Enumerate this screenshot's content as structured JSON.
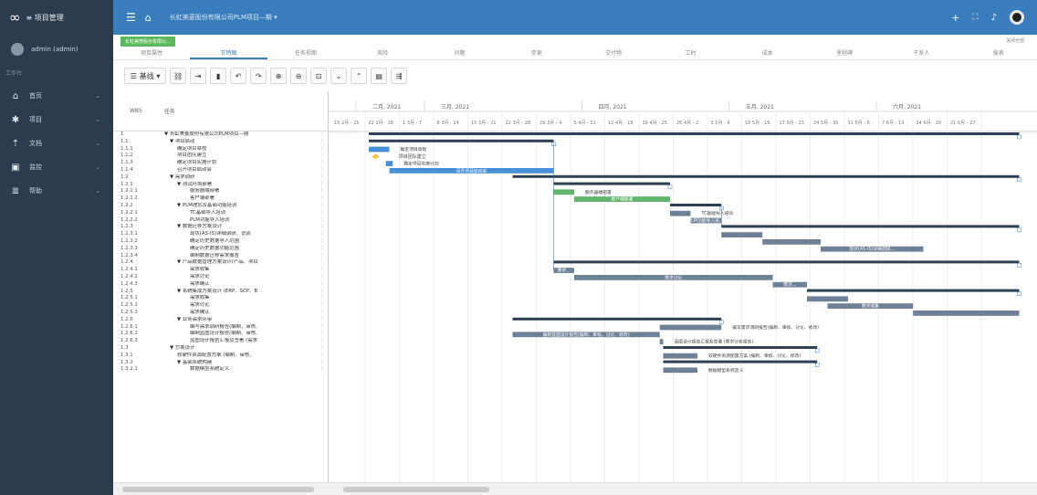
{
  "app": {
    "logo_icon": "cloud-logo-icon",
    "name": "≡ 项目管理"
  },
  "user": {
    "name": "admin (admin)"
  },
  "sidebar": {
    "section": "工作台",
    "items": [
      {
        "icon": "home-icon",
        "label": "首页"
      },
      {
        "icon": "gear-icon",
        "label": "项目"
      },
      {
        "icon": "upload-icon",
        "label": "文档"
      },
      {
        "icon": "chart-icon",
        "label": "监控"
      },
      {
        "icon": "list-icon",
        "label": "帮助"
      }
    ]
  },
  "topbar": {
    "menu_icon": "menu-icon",
    "home_icon": "home-icon",
    "title": "长虹美菱股份有限公司PLM项目—期 ▾",
    "colors": {
      "bar": "#3a7dbd",
      "sidebar": "#2c3b4d"
    }
  },
  "tabrow": {
    "green_tab": "长虹美菱股份有限公...",
    "right_label": "关闭全部"
  },
  "subtabs": [
    "项目属性",
    "甘特图",
    "任务视图",
    "风险",
    "问题",
    "变更",
    "交付物",
    "工时",
    "成本",
    "里程碑",
    "干系人",
    "报表"
  ],
  "active_subtab": 1,
  "toolbar": {
    "view_label": "基线 ▾"
  },
  "grid": {
    "col_wbs": "WBS",
    "col_task": "任务"
  },
  "timeline": {
    "months": [
      "二月, 2021",
      "三月, 2021",
      "四月, 2021",
      "五月, 2021",
      "六月, 2021"
    ],
    "weeks": [
      "15 2月 - 21",
      "22 2月 - 28",
      "1 3月 - 7",
      "8 3月 - 14",
      "15 3月 - 21",
      "22 3月 - 28",
      "29 3月 - 4",
      "5 4月 - 11",
      "12 4月 - 18",
      "19 4月 - 25",
      "26 4月 - 2",
      "3 5月 - 9",
      "10 5月 - 16",
      "17 5月 - 23",
      "24 5月 - 30",
      "31 5月 - 6",
      "7 6月 - 13",
      "14 6月 - 20",
      "21 6月 - 27"
    ]
  },
  "tasks": [
    {
      "wbs": "1",
      "name": "▼ 长虹美菱股份有限公司PLM项目—期",
      "level": 0
    },
    {
      "wbs": "1.1",
      "name": "▼ 项目启动",
      "level": 1
    },
    {
      "wbs": "1.1.1",
      "name": "确定项目章程",
      "level": 2
    },
    {
      "wbs": "1.1.2",
      "name": "项目团队建立",
      "level": 2
    },
    {
      "wbs": "1.1.3",
      "name": "确定项目实施计划",
      "level": 2
    },
    {
      "wbs": "1.1.4",
      "name": "召开项目启动会",
      "level": 2
    },
    {
      "wbs": "1.2",
      "name": "▼ 需求调研",
      "level": 1
    },
    {
      "wbs": "1.2.1",
      "name": "▼ 测试环境部署",
      "level": 2
    },
    {
      "wbs": "1.2.1.1",
      "name": "服务器端部署",
      "level": 3
    },
    {
      "wbs": "1.2.1.2",
      "name": "客户端部署",
      "level": 3
    },
    {
      "wbs": "1.2.2",
      "name": "▼ PLM理念及基础功能培训",
      "level": 2
    },
    {
      "wbs": "1.2.2.1",
      "name": "TC基础导入培训",
      "level": 3
    },
    {
      "wbs": "1.2.2.2",
      "name": "PLM功能导入培训",
      "level": 3
    },
    {
      "wbs": "1.2.3",
      "name": "▼ 数据迁移方案设计",
      "level": 2
    },
    {
      "wbs": "1.2.3.1",
      "name": "现状(AS-IS)详细调研、访谈",
      "level": 3
    },
    {
      "wbs": "1.2.3.2",
      "name": "确定历史数据导入范围",
      "level": 3
    },
    {
      "wbs": "1.2.3.3",
      "name": "确定历史数据功能范围",
      "level": 3
    },
    {
      "wbs": "1.2.3.4",
      "name": "编制数据迁移需求报告",
      "level": 3
    },
    {
      "wbs": "1.2.4",
      "name": "▼ 产品数据管理方案设计(产品、项目",
      "level": 2
    },
    {
      "wbs": "1.2.4.1",
      "name": "需求收集",
      "level": 3
    },
    {
      "wbs": "1.2.4.2",
      "name": "需求讨论",
      "level": 3
    },
    {
      "wbs": "1.2.4.3",
      "name": "需求确认",
      "level": 3
    },
    {
      "wbs": "1.2.5",
      "name": "▼ 系统集成方案设计 (ERP、SCP、B",
      "level": 2
    },
    {
      "wbs": "1.2.5.1",
      "name": "需求收集",
      "level": 3
    },
    {
      "wbs": "1.2.5.2",
      "name": "需求讨论",
      "level": 3
    },
    {
      "wbs": "1.2.5.3",
      "name": "需求确认",
      "level": 3
    },
    {
      "wbs": "1.2.6",
      "name": "▼ 业务需求评审",
      "level": 2
    },
    {
      "wbs": "1.2.6.1",
      "name": "编写需求调研报告(编制、审核、",
      "level": 3
    },
    {
      "wbs": "1.2.6.2",
      "name": "编制蓝图设计报告(编制、审核、",
      "level": 3
    },
    {
      "wbs": "1.2.6.3",
      "name": "蓝图设计报告汇报及签署 (需求",
      "level": 3
    },
    {
      "wbs": "1.3",
      "name": "▼ 方案设计",
      "level": 1
    },
    {
      "wbs": "1.3.1",
      "name": "软硬件资源配置方案 (编制、审核、",
      "level": 2
    },
    {
      "wbs": "1.3.2",
      "name": "▼ 基础系统构建",
      "level": 2
    },
    {
      "wbs": "1.3.2.1",
      "name": "数据模型系统定义",
      "level": 3
    }
  ],
  "bars": [
    {
      "row": 0,
      "start": 0,
      "end": 19,
      "type": "summary",
      "label": ""
    },
    {
      "row": 1,
      "start": 0,
      "end": 5.4,
      "type": "summary",
      "label": ""
    },
    {
      "row": 2,
      "start": 0,
      "end": 0.6,
      "type": "task",
      "label": "确定项目章程",
      "pos": "right"
    },
    {
      "row": 3,
      "start": 0.2,
      "end": 0.5,
      "type": "milestone",
      "label": "项目团队建立",
      "pos": "right"
    },
    {
      "row": 4,
      "start": 0.5,
      "end": 0.7,
      "type": "task",
      "label": "确定项目实施计划",
      "pos": "right"
    },
    {
      "row": 5,
      "start": 0.6,
      "end": 5.4,
      "type": "task",
      "label": "召开项目启动会",
      "pos": "inside"
    },
    {
      "row": 6,
      "start": 4.2,
      "end": 19,
      "type": "summary",
      "label": ""
    },
    {
      "row": 7,
      "start": 5.4,
      "end": 8.8,
      "type": "summary",
      "label": ""
    },
    {
      "row": 8,
      "start": 5.4,
      "end": 6.0,
      "type": "green",
      "label": "服务器端部署",
      "pos": "right"
    },
    {
      "row": 9,
      "start": 6.0,
      "end": 8.8,
      "type": "green",
      "label": "客户端部署",
      "pos": "inside"
    },
    {
      "row": 10,
      "start": 8.8,
      "end": 10.3,
      "type": "summary",
      "label": ""
    },
    {
      "row": 11,
      "start": 8.8,
      "end": 9.4,
      "type": "gray",
      "label": "TC基础导入培训",
      "pos": "right"
    },
    {
      "row": 12,
      "start": 9.4,
      "end": 10.3,
      "type": "gray",
      "label": "PLM功能导入培...",
      "pos": "inside"
    },
    {
      "row": 13,
      "start": 10.3,
      "end": 19,
      "type": "summary",
      "label": ""
    },
    {
      "row": 14,
      "start": 10.3,
      "end": 11.5,
      "type": "gray",
      "label": "",
      "pos": "inside"
    },
    {
      "row": 15,
      "start": 11.5,
      "end": 13.2,
      "type": "gray",
      "label": "",
      "pos": "inside"
    },
    {
      "row": 16,
      "start": 13.2,
      "end": 16.2,
      "type": "gray",
      "label": "现状(AS-IS)详细调研...",
      "pos": "inside"
    },
    {
      "row": 18,
      "start": 5.4,
      "end": 19,
      "type": "summary",
      "label": ""
    },
    {
      "row": 19,
      "start": 5.4,
      "end": 6.0,
      "type": "gray",
      "label": "需求...",
      "pos": "inside"
    },
    {
      "row": 20,
      "start": 6.0,
      "end": 11.8,
      "type": "gray",
      "label": "需求讨论",
      "pos": "inside"
    },
    {
      "row": 21,
      "start": 11.8,
      "end": 12.8,
      "type": "gray",
      "label": "需求...",
      "pos": "inside"
    },
    {
      "row": 22,
      "start": 12.8,
      "end": 19,
      "type": "summary",
      "label": ""
    },
    {
      "row": 23,
      "start": 12.8,
      "end": 14.0,
      "type": "gray",
      "label": "",
      "pos": "inside"
    },
    {
      "row": 24,
      "start": 13.4,
      "end": 15.9,
      "type": "gray",
      "label": "需求收集",
      "pos": "inside"
    },
    {
      "row": 25,
      "start": 15.9,
      "end": 19,
      "type": "gray",
      "label": "",
      "pos": "inside"
    },
    {
      "row": 26,
      "start": 4.2,
      "end": 10.3,
      "type": "summary",
      "label": ""
    },
    {
      "row": 27,
      "start": 8.5,
      "end": 10.3,
      "type": "gray",
      "label": "编写需求调研报告(编制、审核、讨论、修改)",
      "pos": "right"
    },
    {
      "row": 28,
      "start": 4.2,
      "end": 8.5,
      "type": "gray",
      "label": "编制蓝图设计报告(编制、审核、讨论、修改)",
      "pos": "inside"
    },
    {
      "row": 29,
      "start": 8.5,
      "end": 8.6,
      "type": "gray",
      "label": "蓝图设计报告汇报及签署 (需求分析报告)",
      "pos": "right"
    },
    {
      "row": 30,
      "start": 8.6,
      "end": 13.1,
      "type": "summary",
      "label": ""
    },
    {
      "row": 31,
      "start": 8.6,
      "end": 9.6,
      "type": "gray",
      "label": "软硬件资源配置方案 (编制、审核、讨论、修改)",
      "pos": "right"
    },
    {
      "row": 32,
      "start": 8.6,
      "end": 13.1,
      "type": "summary",
      "label": ""
    },
    {
      "row": 33,
      "start": 8.6,
      "end": 9.6,
      "type": "gray",
      "label": "数据模型系统定义",
      "pos": "right"
    }
  ]
}
